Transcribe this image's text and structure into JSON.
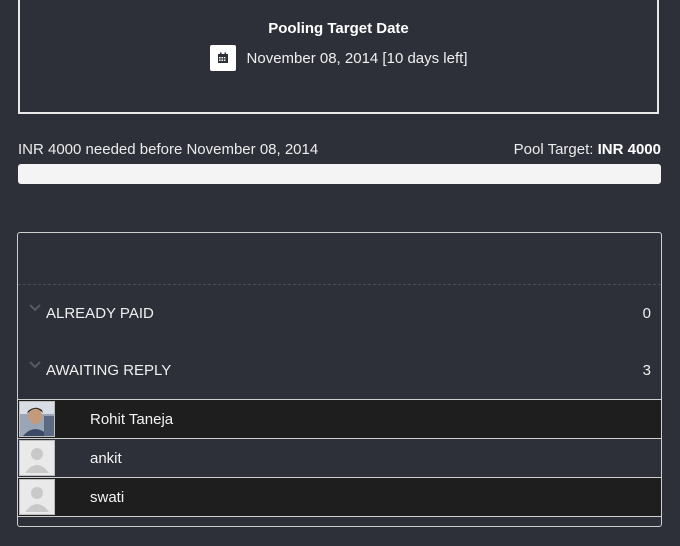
{
  "target": {
    "title": "Pooling Target Date",
    "date_text": "November 08, 2014 [10 days left]"
  },
  "summary": {
    "needed_text": "INR 4000 needed before November 08, 2014",
    "pool_target_label": "Pool Target:",
    "pool_target_value": "INR 4000",
    "progress_fraction": 0
  },
  "sections": [
    {
      "label": "ALREADY PAID",
      "count": "0"
    },
    {
      "label": "AWAITING REPLY",
      "count": "3"
    }
  ],
  "members": [
    {
      "name": "Rohit Taneja",
      "avatar": "photo"
    },
    {
      "name": "ankit",
      "avatar": "default-user-icon"
    },
    {
      "name": "swati",
      "avatar": "default-user-icon"
    }
  ],
  "colors": {
    "background": "#2d3039",
    "row_dark": "#1e1e1e",
    "progress_track": "#f4f4f4"
  }
}
